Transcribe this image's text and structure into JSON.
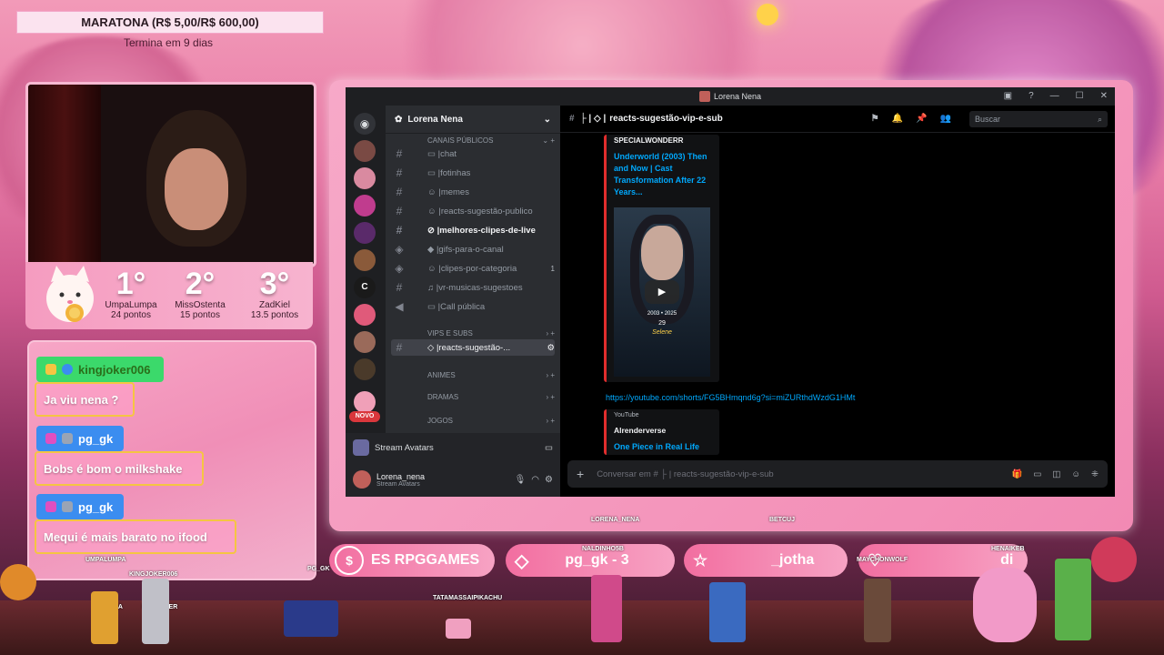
{
  "marathon": {
    "title": "MARATONA (R$ 5,00/R$ 600,00)",
    "subtitle": "Termina em 9 dias"
  },
  "podium": [
    {
      "place": "1°",
      "name": "UmpaLumpa",
      "points": "24 pontos"
    },
    {
      "place": "2°",
      "name": "MissOstenta",
      "points": "15 pontos"
    },
    {
      "place": "3°",
      "name": "ZadKiel",
      "points": "13.5 pontos"
    }
  ],
  "chat": [
    {
      "user": "kingjoker006",
      "message": "Ja viu nena ?"
    },
    {
      "user": "pg_gk",
      "message": "Bobs é bom o milkshake"
    },
    {
      "user": "pg_gk",
      "message": "Mequi é mais barato no ifood"
    }
  ],
  "discord": {
    "window_title": "Lorena Nena",
    "server_name": "Lorena Nena",
    "categories": [
      "CANAIS PÚBLICOS",
      "VIPS E SUBS",
      "ANIMES",
      "DRAMAS",
      "JOGOS"
    ],
    "channels": [
      {
        "name": "chat",
        "count": ""
      },
      {
        "name": "fotinhas",
        "count": ""
      },
      {
        "name": "memes",
        "count": ""
      },
      {
        "name": "reacts-sugestão-publico",
        "count": ""
      },
      {
        "name": "melhores-clipes-de-live",
        "count": ""
      },
      {
        "name": "gifs-para-o-canal",
        "count": ""
      },
      {
        "name": "clipes-por-categoria",
        "count": "1"
      },
      {
        "name": "vr-musicas-sugestoes",
        "count": ""
      },
      {
        "name": "Call pública",
        "count": ""
      }
    ],
    "selected_channel": "reacts-sugestão-...",
    "new_badge": "NOVO",
    "stream_avatars": "Stream Avatars",
    "user": {
      "name": "Lorena_nena",
      "status": "Stream Avatars"
    },
    "topbar_channel": "reacts-sugestão-vip-e-sub",
    "search_placeholder": "Buscar",
    "embed1": {
      "author": "SPECIALWONDERR",
      "title": "Underworld (2003) Then and Now | Cast Transformation After 22 Years...",
      "thumb_years": "2003 • 2025",
      "thumb_age": "29",
      "thumb_name": "Selene"
    },
    "link": "https://youtube.com/shorts/FG5BHmqnd6g?si=miZURthdWzdG1HMt",
    "embed2": {
      "provider": "YouTube",
      "author": "Alrenderverse",
      "title": "One Piece in Real Life"
    },
    "input_placeholder": "Conversar em # ├ | reacts-sugestão-vip-e-sub"
  },
  "goals": [
    {
      "text": "ES  RPGGAMES"
    },
    {
      "text": "pg_gk - 3"
    },
    {
      "text": "_jotha"
    },
    {
      "text": "di"
    }
  ],
  "sprite_names": [
    "UMPALUMPA",
    "KINGJOKER006",
    "PG_GK",
    "TATAMASSAIPIKACHU",
    "LORENA_NENA",
    "BETCUJ",
    "NALDINHO5B",
    "MAYCHONWOLF",
    "HENAIKEB",
    "KAVEIRA",
    "BARLABER"
  ],
  "colors": {
    "discord_bg": "#1e1f22",
    "channels_bg": "#2b2d31",
    "link": "#00a8fc",
    "embed_bar": "#e02d2d",
    "chat_green": "#3bd96b",
    "chat_blue": "#3b8df0"
  }
}
